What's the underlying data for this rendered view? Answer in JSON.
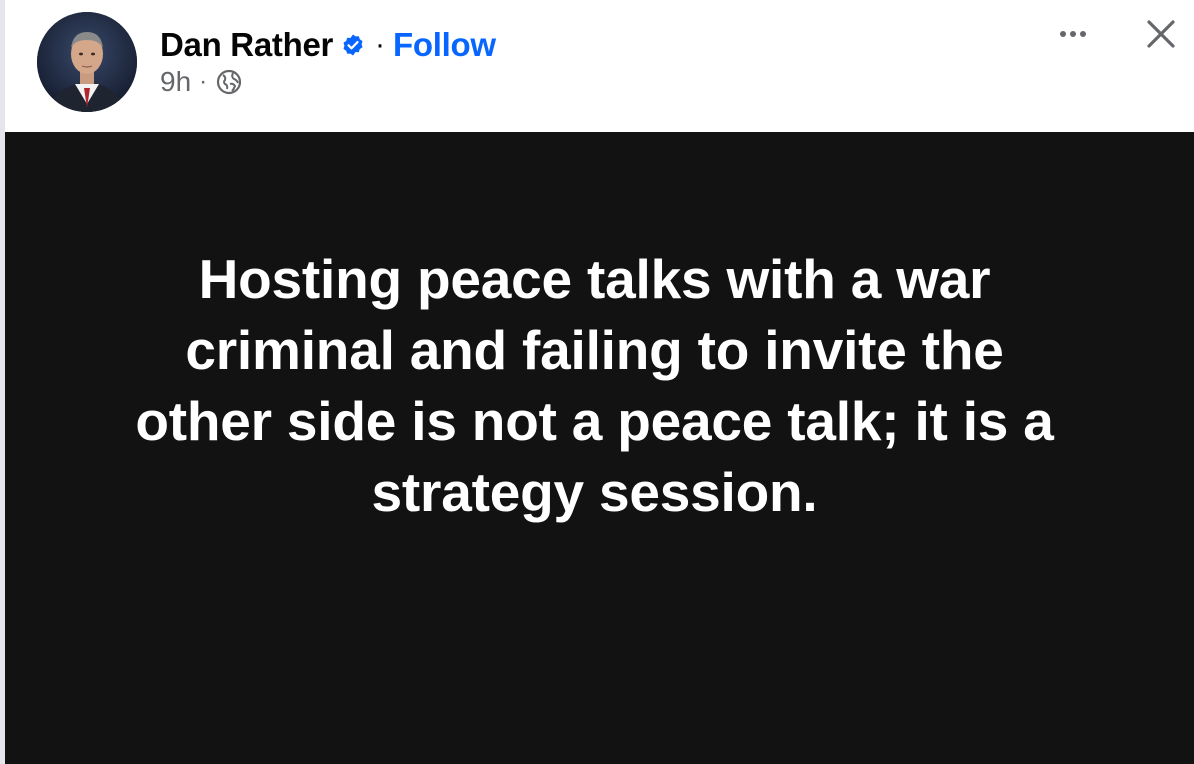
{
  "post": {
    "author": {
      "name": "Dan Rather",
      "verified": true,
      "avatar_alt": "Dan Rather profile photo"
    },
    "separator": "·",
    "follow_label": "Follow",
    "timestamp": "9h",
    "meta_separator": "·",
    "audience_icon": "globe-icon",
    "more_icon": "more-horizontal-icon",
    "close_icon": "close-icon",
    "image_text_lines": [
      "Hosting peace talks with a war",
      "criminal and failing to invite the",
      "other side is not a peace talk; it is a",
      "strategy session."
    ]
  },
  "colors": {
    "follow": "#0866ff",
    "verified_badge": "#0866ff",
    "post_background": "#121212",
    "post_text": "#ffffff",
    "secondary_text": "#65676b"
  }
}
